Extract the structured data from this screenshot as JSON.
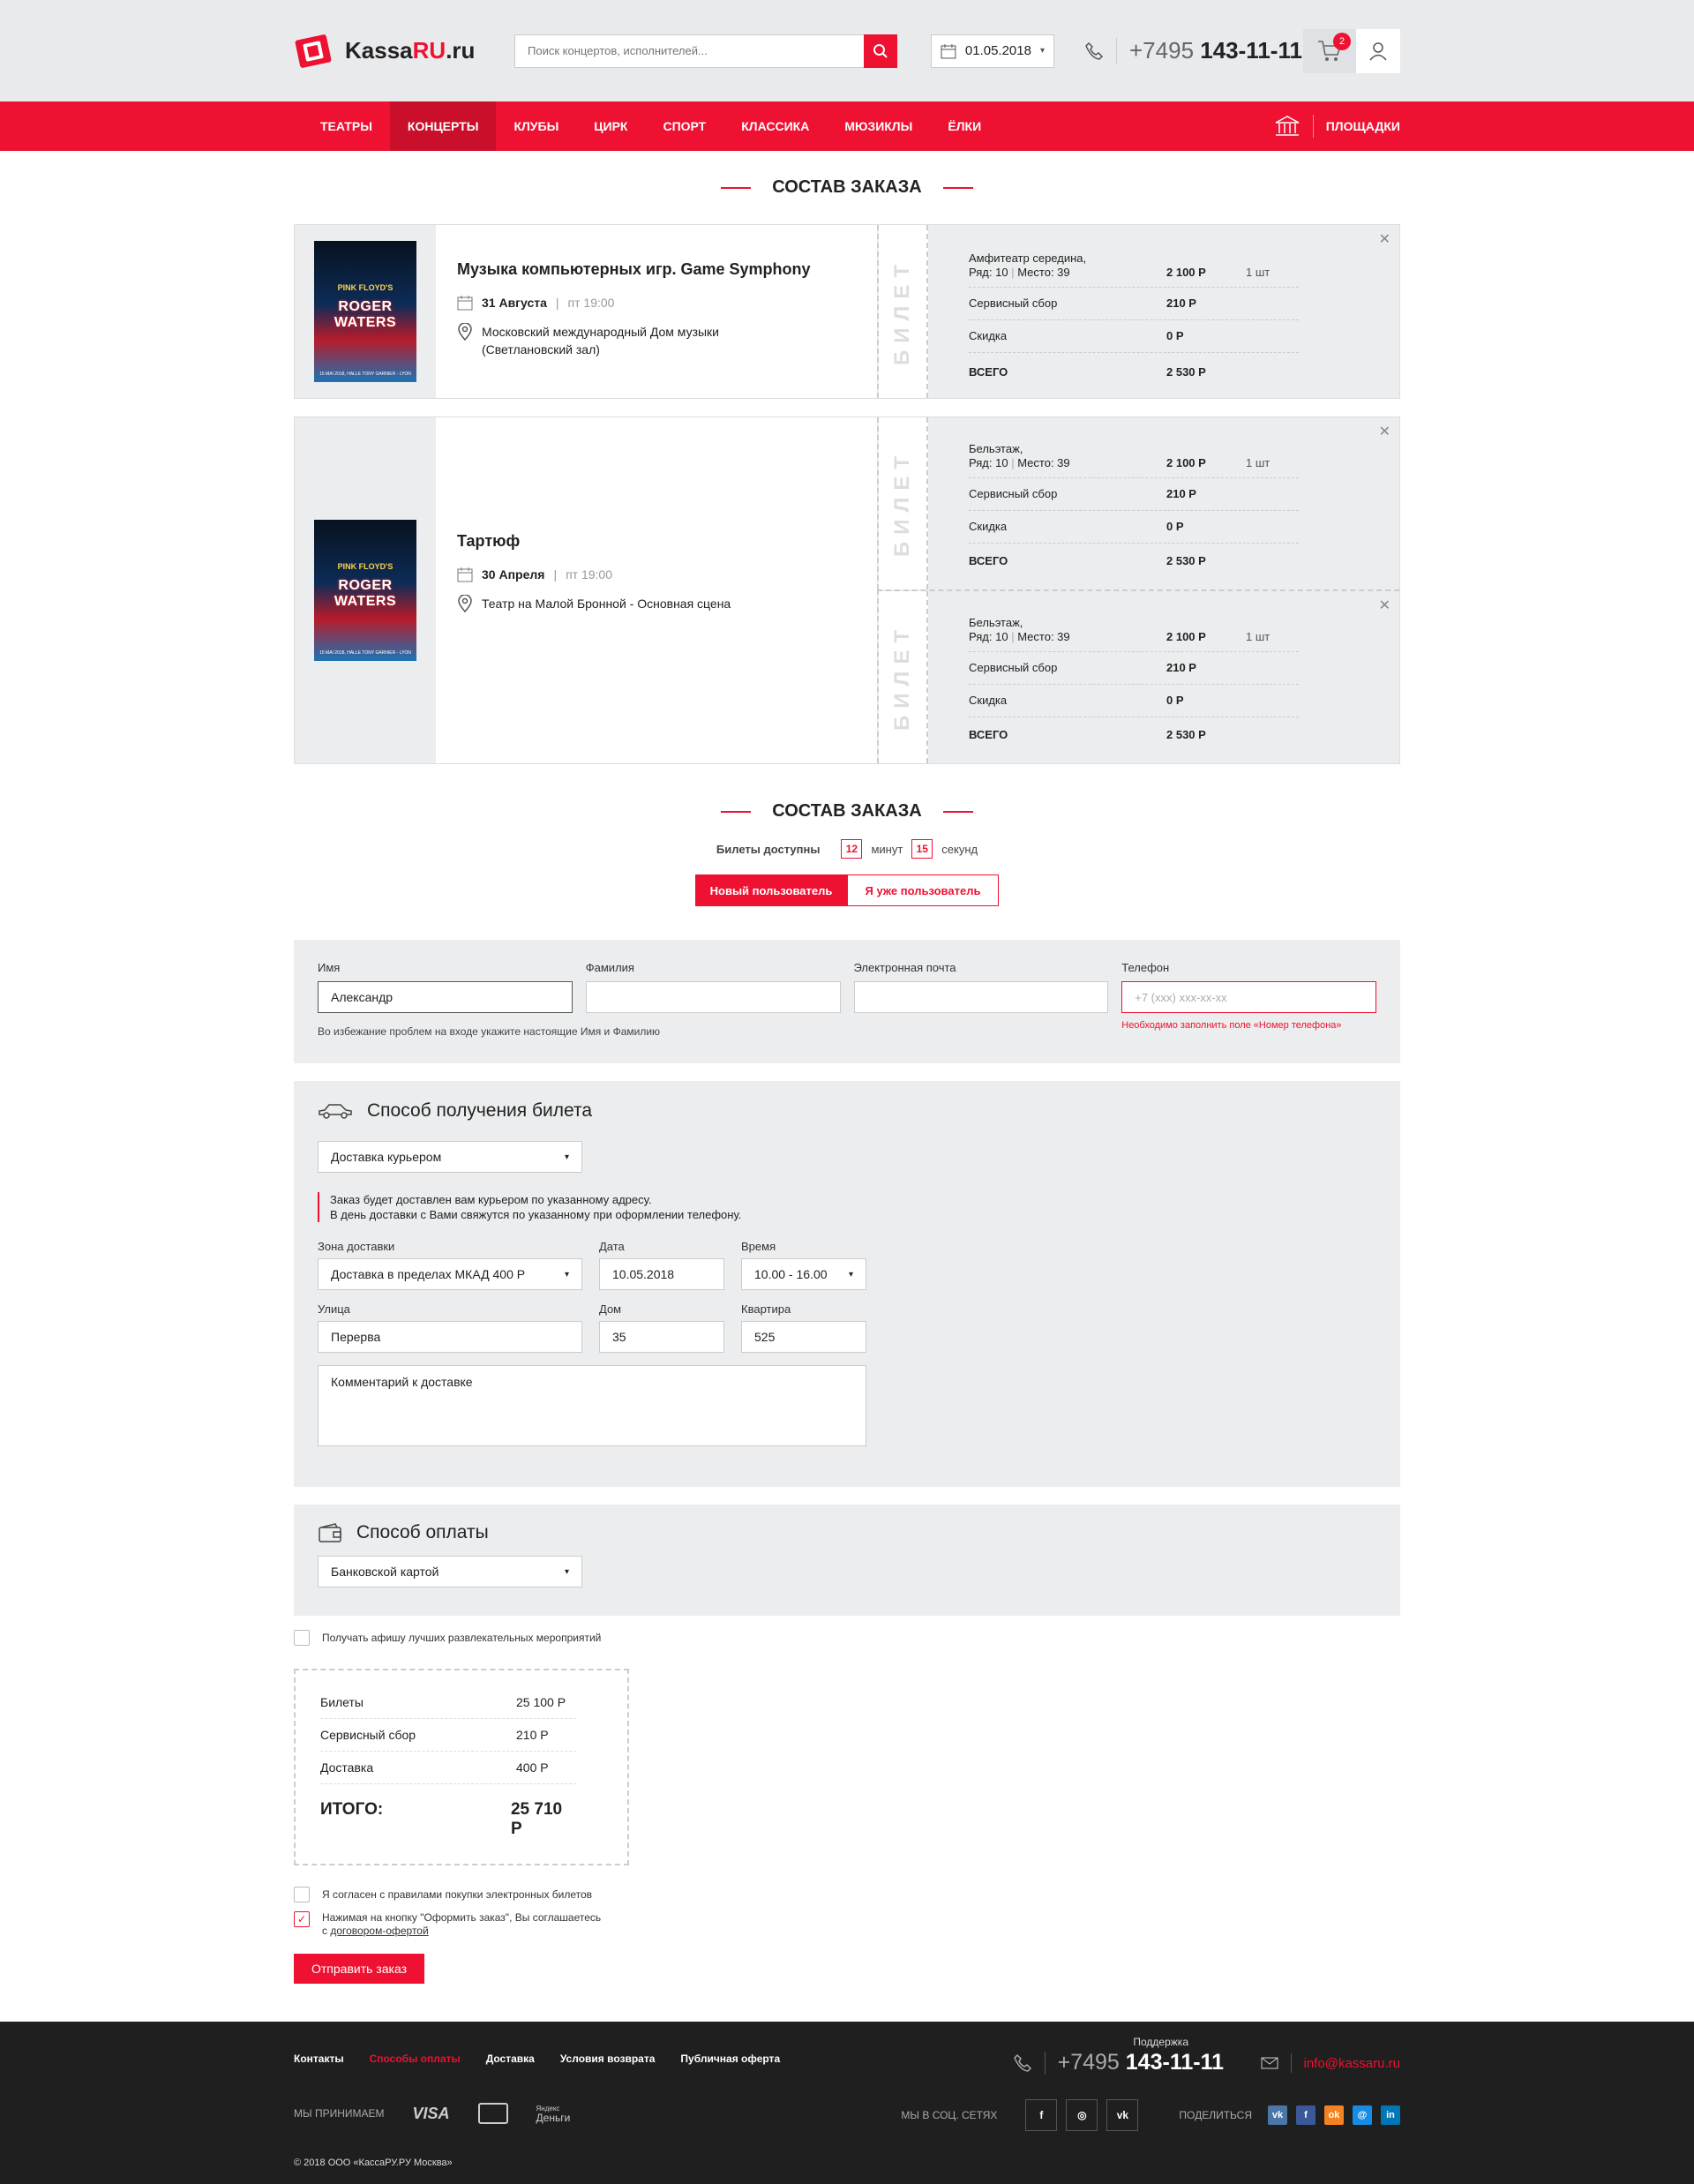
{
  "header": {
    "logo": "KassaRU.ru",
    "logo_prefix": "Kassa",
    "logo_accent": "RU",
    "logo_suffix": ".ru",
    "search_placeholder": "Поиск концертов, исполнителей...",
    "date": "01.05.2018",
    "phone_prefix": "+7495",
    "phone_number": "143-11-11",
    "cart_count": "2"
  },
  "nav": {
    "items": [
      "ТЕАТРЫ",
      "КОНЦЕРТЫ",
      "КЛУБЫ",
      "ЦИРК",
      "СПОРТ",
      "КЛАССИКА",
      "МЮЗИКЛЫ",
      "ЁЛКИ"
    ],
    "active": "КОНЦЕРТЫ",
    "venues": "ПЛОЩАДКИ"
  },
  "order_title": "СОСТАВ ЗАКАЗА",
  "poster": {
    "top": "PINK FLOYD'S",
    "title": "ROGER WATERS",
    "bottom": "15 MAI 2018, HALLE TONY GARNIER - LYON"
  },
  "stub_label": "БИЛЕТ",
  "orders": [
    {
      "title": "Музыка компьютерных игр. Game Symphony",
      "date": "31 Августа",
      "time": "пт 19:00",
      "venue_line1": "Московский международный Дом музыки",
      "venue_line2": "(Светлановский зал)",
      "tickets": [
        {
          "seat_line1": "Амфитеатр середина,",
          "row": "Ряд: 10",
          "place": "Место: 39",
          "price": "2 100 Р",
          "qty": "1 шт",
          "service_label": "Сервисный сбор",
          "service": "210 Р",
          "discount_label": "Скидка",
          "discount": "0 Р",
          "total_label": "ВСЕГО",
          "total": "2 530 Р"
        }
      ]
    },
    {
      "title": "Тартюф",
      "date": "30 Апреля",
      "time": "пт 19:00",
      "venue_line1": "Театр на Малой Бронной - Основная сцена",
      "venue_line2": "",
      "tickets": [
        {
          "seat_line1": "Бельэтаж,",
          "row": "Ряд: 10",
          "place": "Место: 39",
          "price": "2 100 Р",
          "qty": "1 шт",
          "service_label": "Сервисный сбор",
          "service": "210 Р",
          "discount_label": "Скидка",
          "discount": "0 Р",
          "total_label": "ВСЕГО",
          "total": "2 530 Р"
        },
        {
          "seat_line1": "Бельэтаж,",
          "row": "Ряд: 10",
          "place": "Место: 39",
          "price": "2 100 Р",
          "qty": "1 шт",
          "service_label": "Сервисный сбор",
          "service": "210 Р",
          "discount_label": "Скидка",
          "discount": "0 Р",
          "total_label": "ВСЕГО",
          "total": "2 530 Р"
        }
      ]
    }
  ],
  "timer": {
    "label": "Билеты доступны",
    "minutes": "12",
    "min_label": "минут",
    "seconds": "15",
    "sec_label": "секунд"
  },
  "tabs": {
    "new_user": "Новый пользователь",
    "existing_user": "Я уже пользователь"
  },
  "contact": {
    "name_label": "Имя",
    "name_value": "Александр",
    "surname_label": "Фамилия",
    "surname_value": "",
    "email_label": "Электронная почта",
    "email_value": "",
    "phone_label": "Телефон",
    "phone_placeholder": "+7 (xxx) xxx-xx-xx",
    "hint": "Во избежание проблем на входе укажите настоящие Имя и Фамилию",
    "phone_error": "Необходимо заполнить поле «Номер телефона»"
  },
  "delivery": {
    "title": "Способ получения билета",
    "method": "Доставка курьером",
    "note_line1": "Заказ будет доставлен вам курьером по указанному адресу.",
    "note_line2": "В день доставки с Вами свяжутся по указанному при оформлении телефону.",
    "zone_label": "Зона доставки",
    "zone_value": "Доставка в пределах МКАД 400 Р",
    "date_label": "Дата",
    "date_value": "10.05.2018",
    "time_label": "Время",
    "time_value": "10.00 - 16.00",
    "street_label": "Улица",
    "street_value": "Перерва",
    "house_label": "Дом",
    "house_value": "35",
    "flat_label": "Квартира",
    "flat_value": "525",
    "comment_placeholder": "Комментарий к доставке"
  },
  "payment": {
    "title": "Способ оплаты",
    "method": "Банковской картой"
  },
  "newsletter": "Получать афишу лучших развлекательных мероприятий",
  "summary": {
    "tickets_label": "Билеты",
    "tickets": "25 100 Р",
    "service_label": "Сервисный сбор",
    "service": "210 Р",
    "delivery_label": "Доставка",
    "delivery": "400 Р",
    "total_label": "ИТОГО:",
    "total": "25 710 Р"
  },
  "agree_rules": "Я согласен с правилами покупки электронных билетов",
  "agree_offer_prefix": "Нажимая на кнопку \"Оформить заказ\", Вы соглашаетесь",
  "agree_offer_with": "с",
  "agree_offer_link": "договором-офертой",
  "submit": "Отправить заказ",
  "footer": {
    "links": [
      "Контакты",
      "Способы оплаты",
      "Доставка",
      "Условия возврата",
      "Публичная оферта"
    ],
    "active_link": "Способы оплаты",
    "support": "Поддержка",
    "phone_prefix": "+7495",
    "phone_number": "143-11-11",
    "email": "info@kassaru.ru",
    "accept": "МЫ ПРИНИМАЕМ",
    "visa": "VISA",
    "yandex_small": "Яндекс",
    "yandex": "Деньги",
    "social": "МЫ В СОЦ. СЕТЯХ",
    "share": "ПОДЕЛИТЬСЯ",
    "copyright": "© 2018 ООО «КассаРУ.РУ Москва»"
  },
  "colors": {
    "accent": "#ee1131",
    "panel": "#ecedee",
    "footer": "#1f1f1f"
  }
}
